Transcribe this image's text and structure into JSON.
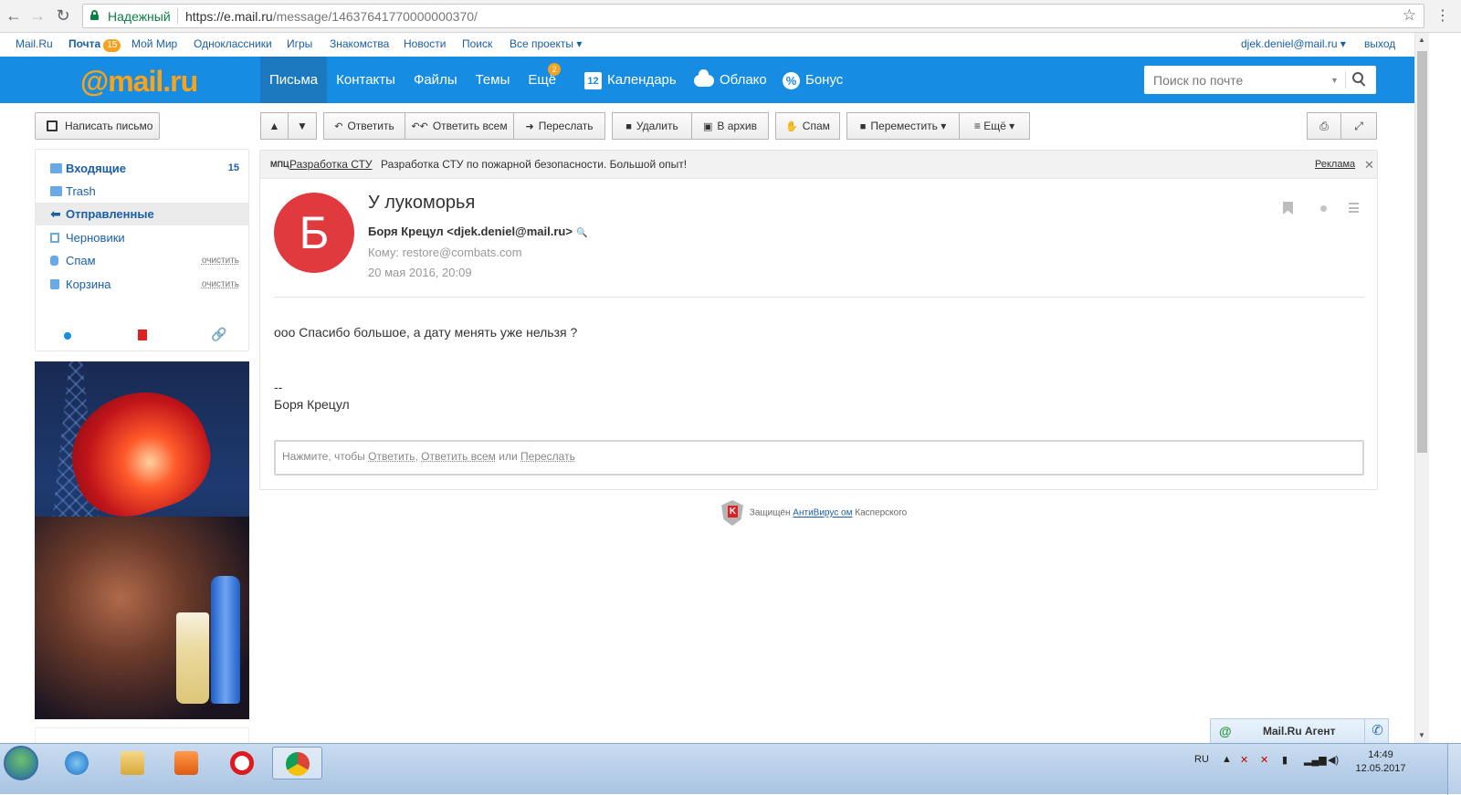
{
  "browser": {
    "secure_label": "Надежный",
    "url_host": "https://e.mail.ru",
    "url_path": "/message/14637641770000000370/"
  },
  "portal": {
    "mailru": "Mail.Ru",
    "mail": "Почта",
    "mail_count": "15",
    "links": [
      "Мой Мир",
      "Одноклассники",
      "Игры",
      "Знакомства",
      "Новости",
      "Поиск",
      "Все проекты ▾"
    ],
    "user": "djek.deniel@mail.ru ▾",
    "logout": "выход"
  },
  "header": {
    "logo_at": "@",
    "logo_text": "mail.ru",
    "tabs": [
      "Письма",
      "Контакты",
      "Файлы",
      "Темы",
      "Ещё"
    ],
    "more_badge": "2",
    "calendar_day": "12",
    "calendar": "Календарь",
    "cloud": "Облако",
    "bonus": "Бонус",
    "search_placeholder": "Поиск по почте"
  },
  "sidebar": {
    "compose": "Написать письмо",
    "folders": [
      {
        "label": "Входящие",
        "count": "15"
      },
      {
        "label": "Trash"
      },
      {
        "label": "Отправленные"
      },
      {
        "label": "Черновики"
      },
      {
        "label": "Спам",
        "action": "очистить"
      },
      {
        "label": "Корзина",
        "action": "очистить"
      }
    ]
  },
  "toolbar": {
    "reply": "Ответить",
    "reply_all": "Ответить всем",
    "forward": "Переслать",
    "delete": "Удалить",
    "archive": "В архив",
    "spam": "Спам",
    "move": "Переместить ▾",
    "more": "≡ Ещё ▾"
  },
  "ad_line": {
    "brand": "МПЦ",
    "link": "Разработка СТУ",
    "text": "Разработка СТУ по пожарной безопасности. Большой опыт!",
    "label": "Реклама"
  },
  "message": {
    "avatar_letter": "Б",
    "subject": "У лукоморья",
    "from": "Боря Крецул <djek.deniel@mail.ru>",
    "to": "Кому: restore@combats.com",
    "date": "20 мая 2016, 20:09",
    "body": "ооо Спасибо большое, а дату менять уже нельзя ?",
    "sig_dash": "--",
    "sig_name": "Боря Крецул",
    "reply_prefix": "Нажмите, чтобы",
    "reply_link": "Ответить",
    "reply_all_link": "Ответить всем",
    "reply_or": "или",
    "forward_link": "Переслать"
  },
  "kaspersky": {
    "prefix": "Защищён",
    "link": "АнтиВирус ом",
    "suffix": "Касперского"
  },
  "agent": {
    "name": "Mail.Ru Агент"
  },
  "taskbar": {
    "lang": "RU",
    "time": "14:49",
    "date": "12.05.2017"
  }
}
